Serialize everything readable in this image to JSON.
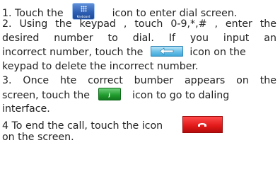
{
  "instructions": {
    "step1": {
      "before": "1. Touch the",
      "icon_caption": "Keyboard",
      "after": "icon to enter dial screen."
    },
    "step2": {
      "line1": "2. Using the keypad , touch 0-9,*,# , enter the",
      "line2": "desired number to dial. If you input an",
      "line3_before": "incorrect number, touch the",
      "line3_after": "icon on the",
      "line4": "keypad to delete the incorrect number."
    },
    "step3": {
      "line1": "3. Once hte correct bumber appears on the",
      "line2_before": "screen, touch the",
      "line2_after": "icon to go to daling",
      "line3": "interface."
    },
    "step4": {
      "line1_before": "4 To end the call, touch the icon",
      "line2": "on the screen."
    }
  },
  "icons": {
    "keypad": "keypad-icon",
    "backspace": "backspace-icon",
    "call": "call-icon",
    "end_call": "end-call-icon",
    "colors": {
      "keypad": "#2e5fb3",
      "backspace": "#6fc3ea",
      "call": "#1f9a2c",
      "end_call": "#e11818"
    }
  }
}
